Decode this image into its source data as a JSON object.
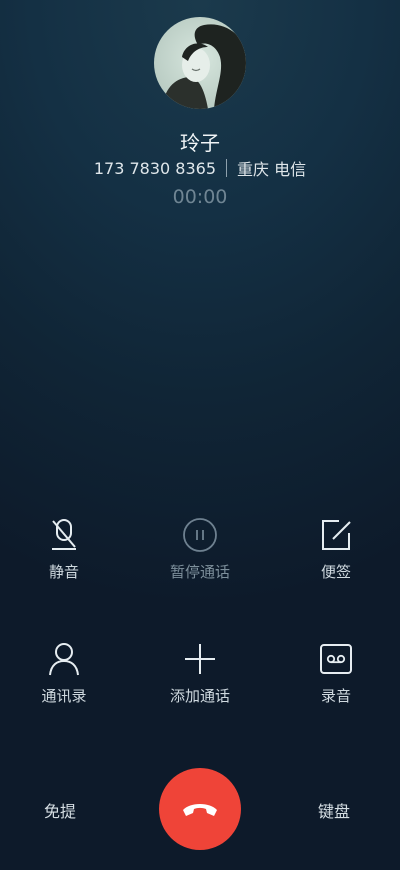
{
  "caller": {
    "name": "玲子",
    "number": "173 7830 8365",
    "location": "重庆 电信",
    "timer": "00:00"
  },
  "controls": {
    "mute": "静音",
    "hold": "暂停通话",
    "notes": "便签",
    "contacts": "通讯录",
    "add_call": "添加通话",
    "record": "录音"
  },
  "bottom": {
    "speaker": "免提",
    "keypad": "键盘"
  },
  "colors": {
    "end_call": "#ef4438",
    "background_top": "#1b3a4c",
    "background_bottom": "#0d1a2a"
  }
}
